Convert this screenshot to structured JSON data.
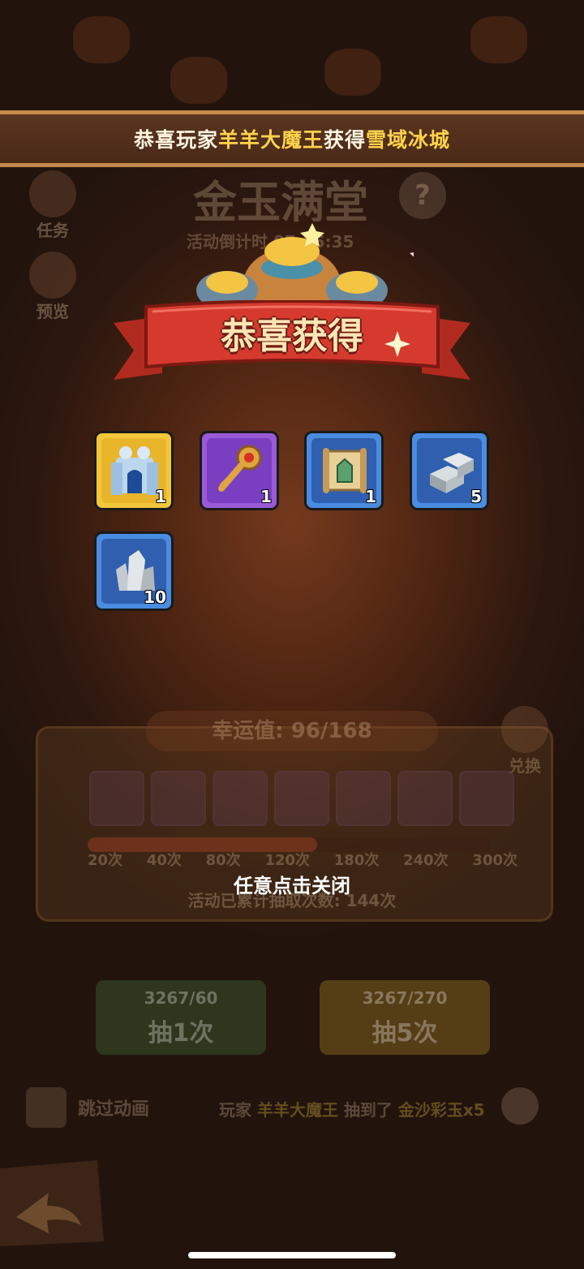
{
  "ticker": {
    "prefix": "恭喜玩家",
    "player": "羊羊大魔王",
    "middle": "获得",
    "item": "雪域冰城"
  },
  "background": {
    "event_title": "金玉满堂",
    "countdown": "活动倒计时 07:05:35",
    "side_task": "任务",
    "side_preview": "预览",
    "exchange": "兑换",
    "help_icon": "question-icon"
  },
  "popup": {
    "title": "恭喜获得",
    "items": [
      {
        "name": "ice-castle-icon",
        "rarity": "gold",
        "count": "1"
      },
      {
        "name": "key-icon",
        "rarity": "purple",
        "count": "1"
      },
      {
        "name": "scroll-map-icon",
        "rarity": "blue",
        "count": "1"
      },
      {
        "name": "stone-block-icon",
        "rarity": "blue",
        "count": "5"
      },
      {
        "name": "stone-ore-icon",
        "rarity": "blue",
        "count": "10"
      }
    ],
    "close_hint": "任意点击关闭"
  },
  "lucky": {
    "label": "幸运值: 96/168",
    "progress_fraction": 0.57,
    "milestones": [
      "20次",
      "40次",
      "80次",
      "120次",
      "180次",
      "240次",
      "300次"
    ],
    "total_draws": "活动已累计抽取次数: 144次"
  },
  "draw_buttons": [
    {
      "cost": "3267/60",
      "label": "抽1次"
    },
    {
      "cost": "3267/270",
      "label": "抽5次"
    }
  ],
  "bottom": {
    "skip_label": "跳过动画",
    "news_prefix": "玩家",
    "news_player": "羊羊大魔王",
    "news_middle": "抽到了",
    "news_item": "金沙彩玉x5"
  },
  "colors": {
    "gold_frame": "#f2c63a",
    "purple_frame": "#9a5ad8",
    "blue_frame": "#4a8ce0",
    "ribbon_red": "#d63a2e",
    "highlight_yellow": "#ffd24a"
  }
}
